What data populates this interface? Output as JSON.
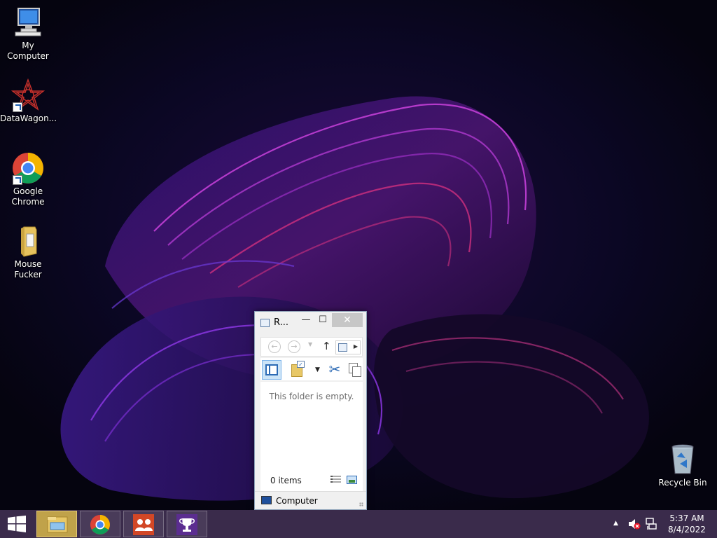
{
  "desktop": {
    "icons": [
      {
        "label": "My Computer",
        "icon": "computer-icon"
      },
      {
        "label": "DataWagon...",
        "icon": "datawagon-icon"
      },
      {
        "label": "Google\nChrome",
        "icon": "chrome-icon"
      },
      {
        "label": "Mouse Fucker",
        "icon": "folder-icon"
      },
      {
        "label": "Recycle Bin",
        "icon": "recycle-bin-icon"
      }
    ]
  },
  "explorer": {
    "title": "R...",
    "minimize": "—",
    "maximize": "☐",
    "close": "✕",
    "back": "←",
    "forward": "→",
    "up": "↑",
    "empty_message": "This folder is empty.",
    "status": "0 items",
    "location": "Computer"
  },
  "taskbar": {
    "apps": [
      "file-explorer",
      "google-chrome",
      "people-app",
      "trophy-app"
    ],
    "time": "5:37 AM",
    "date": "8/4/2022"
  },
  "colors": {
    "taskbar": "#3a2b4b",
    "wallpaper_dark": "#07051a",
    "accent_purple": "#8a2be2",
    "accent_magenta": "#c2186b"
  }
}
